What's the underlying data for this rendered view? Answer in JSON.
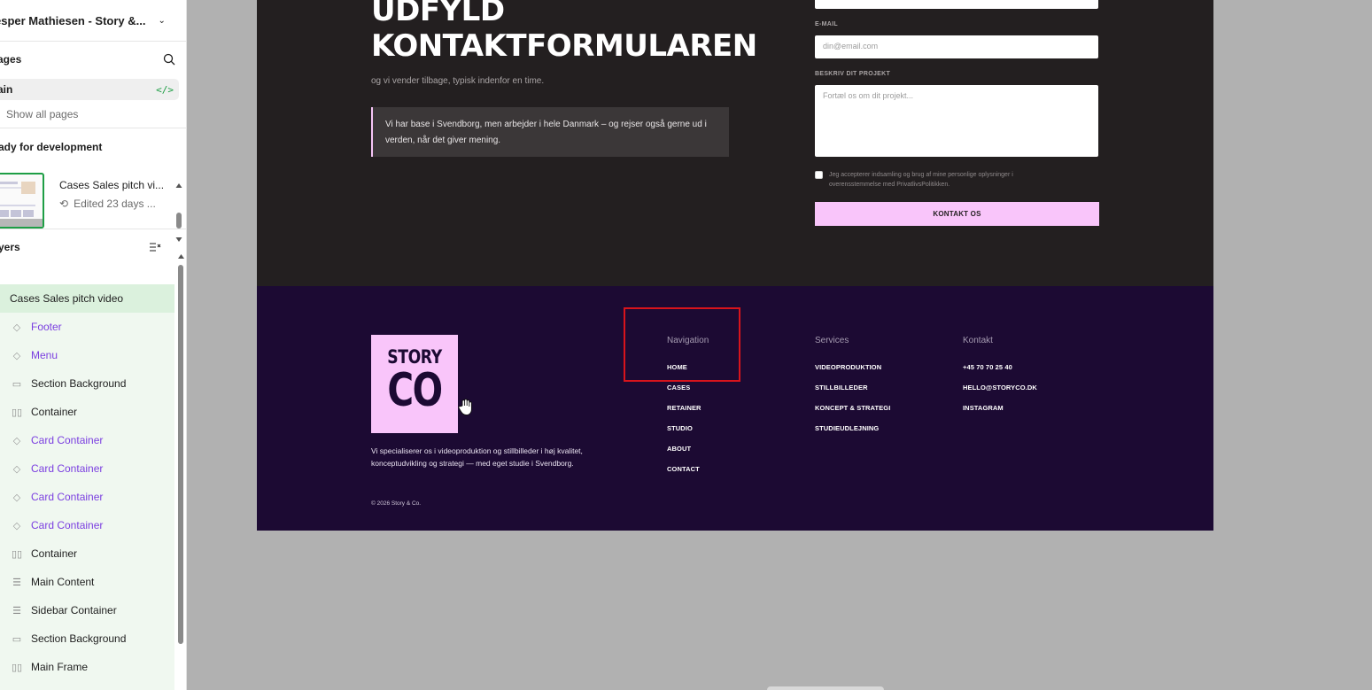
{
  "sidebar": {
    "file_title": "esper Mathiesen - Story &...",
    "pages_label": "ages",
    "current_page": "ain",
    "show_all": "Show all pages",
    "ready_label": "ady for development",
    "file_card": {
      "name": "Cases Sales pitch vi...",
      "edited": "Edited 23 days ..."
    },
    "layers_label": "yers",
    "layers": [
      {
        "label": "Cases Sales pitch video",
        "icon": "none",
        "type": "selected"
      },
      {
        "label": "Footer",
        "icon": "component-icon",
        "type": "component"
      },
      {
        "label": "Menu",
        "icon": "component-icon",
        "type": "component"
      },
      {
        "label": "Section Background",
        "icon": "rectangle-icon",
        "type": "frame"
      },
      {
        "label": "Container",
        "icon": "auto-layout-horizontal-icon",
        "type": "frame"
      },
      {
        "label": "Card Container",
        "icon": "component-icon",
        "type": "component"
      },
      {
        "label": "Card Container",
        "icon": "component-icon",
        "type": "component"
      },
      {
        "label": "Card Container",
        "icon": "component-icon",
        "type": "component"
      },
      {
        "label": "Card Container",
        "icon": "component-icon",
        "type": "component"
      },
      {
        "label": "Container",
        "icon": "auto-layout-horizontal-icon",
        "type": "frame"
      },
      {
        "label": "Main Content",
        "icon": "auto-layout-vertical-icon",
        "type": "frame"
      },
      {
        "label": "Sidebar Container",
        "icon": "auto-layout-vertical-icon",
        "type": "frame"
      },
      {
        "label": "Section Background",
        "icon": "rectangle-icon",
        "type": "frame"
      },
      {
        "label": "Main Frame",
        "icon": "auto-layout-horizontal-icon",
        "type": "frame"
      }
    ]
  },
  "contact": {
    "heading_line1": "UDFYLD",
    "heading_line2": "KONTAKTFORMULAREN",
    "subtitle": "og vi vender tilbage, typisk indenfor en time.",
    "note": "Vi har base i Svendborg, men arbejder i hele Danmark – og rejser også gerne ud i verden, når det giver mening.",
    "email_label": "E-MAIL",
    "email_placeholder": "din@email.com",
    "project_label": "BESKRIV DIT PROJEKT",
    "project_placeholder": "Fortæl os om dit projekt...",
    "consent": "Jeg accepterer indsamling og brug af mine personlige oplysninger i overensstemmelse med PrivatlivsPolitikken.",
    "submit": "KONTAKT OS"
  },
  "footer": {
    "logo_line1": "STORY",
    "logo_line2": "CO",
    "description": "Vi specialiserer os i videoproduktion og stillbilleder i høj kvalitet, konceptudvikling og strategi — med eget studie i Svendborg.",
    "copyright": "© 2026 Story & Co.",
    "navigation": {
      "title": "Navigation",
      "links": [
        "HOME",
        "CASES",
        "RETAINER",
        "STUDIO",
        "ABOUT",
        "CONTACT"
      ]
    },
    "services": {
      "title": "Services",
      "links": [
        "VIDEOPRODUKTION",
        "STILLBILLEDER",
        "KONCEPT & STRATEGI",
        "STUDIEUDLEJNING"
      ]
    },
    "kontakt": {
      "title": "Kontakt",
      "links": [
        "+45 70 70 25 40",
        "HELLO@STORYCO.DK",
        "INSTAGRAM"
      ]
    }
  },
  "colors": {
    "accent_pink": "#f9c5fa",
    "dark_section": "#231f20",
    "footer_bg": "#1c0a33",
    "component_purple": "#7b3fe0",
    "selection_green": "#1e9e45",
    "highlight_red": "#d8141c"
  }
}
